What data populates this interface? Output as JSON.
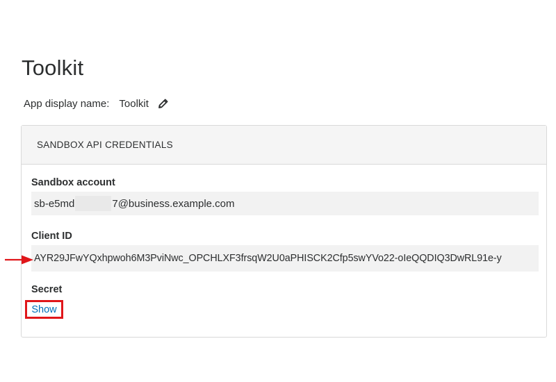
{
  "page": {
    "title": "Toolkit"
  },
  "display_name": {
    "label": "App display name:",
    "value": "Toolkit",
    "edit_icon": "pencil-icon"
  },
  "credentials": {
    "header": "SANDBOX API CREDENTIALS",
    "sandbox_account": {
      "label": "Sandbox account",
      "value_start": "sb-e5md",
      "value_end": "7@business.example.com"
    },
    "client_id": {
      "label": "Client ID",
      "value": "AYR29JFwYQxhpwoh6M3PviNwc_OPCHLXF3frsqW2U0aPHISCK2Cfp5swYVo22-oIeQQDIQ3DwRL91e-y"
    },
    "secret": {
      "label": "Secret",
      "show_label": "Show"
    }
  },
  "annotations": {
    "arrow_icon": "red-arrow-icon",
    "highlight_color": "#e0161a"
  },
  "colors": {
    "link": "#0070ba",
    "text": "#2c2e2f",
    "field_bg": "#f2f2f2"
  }
}
